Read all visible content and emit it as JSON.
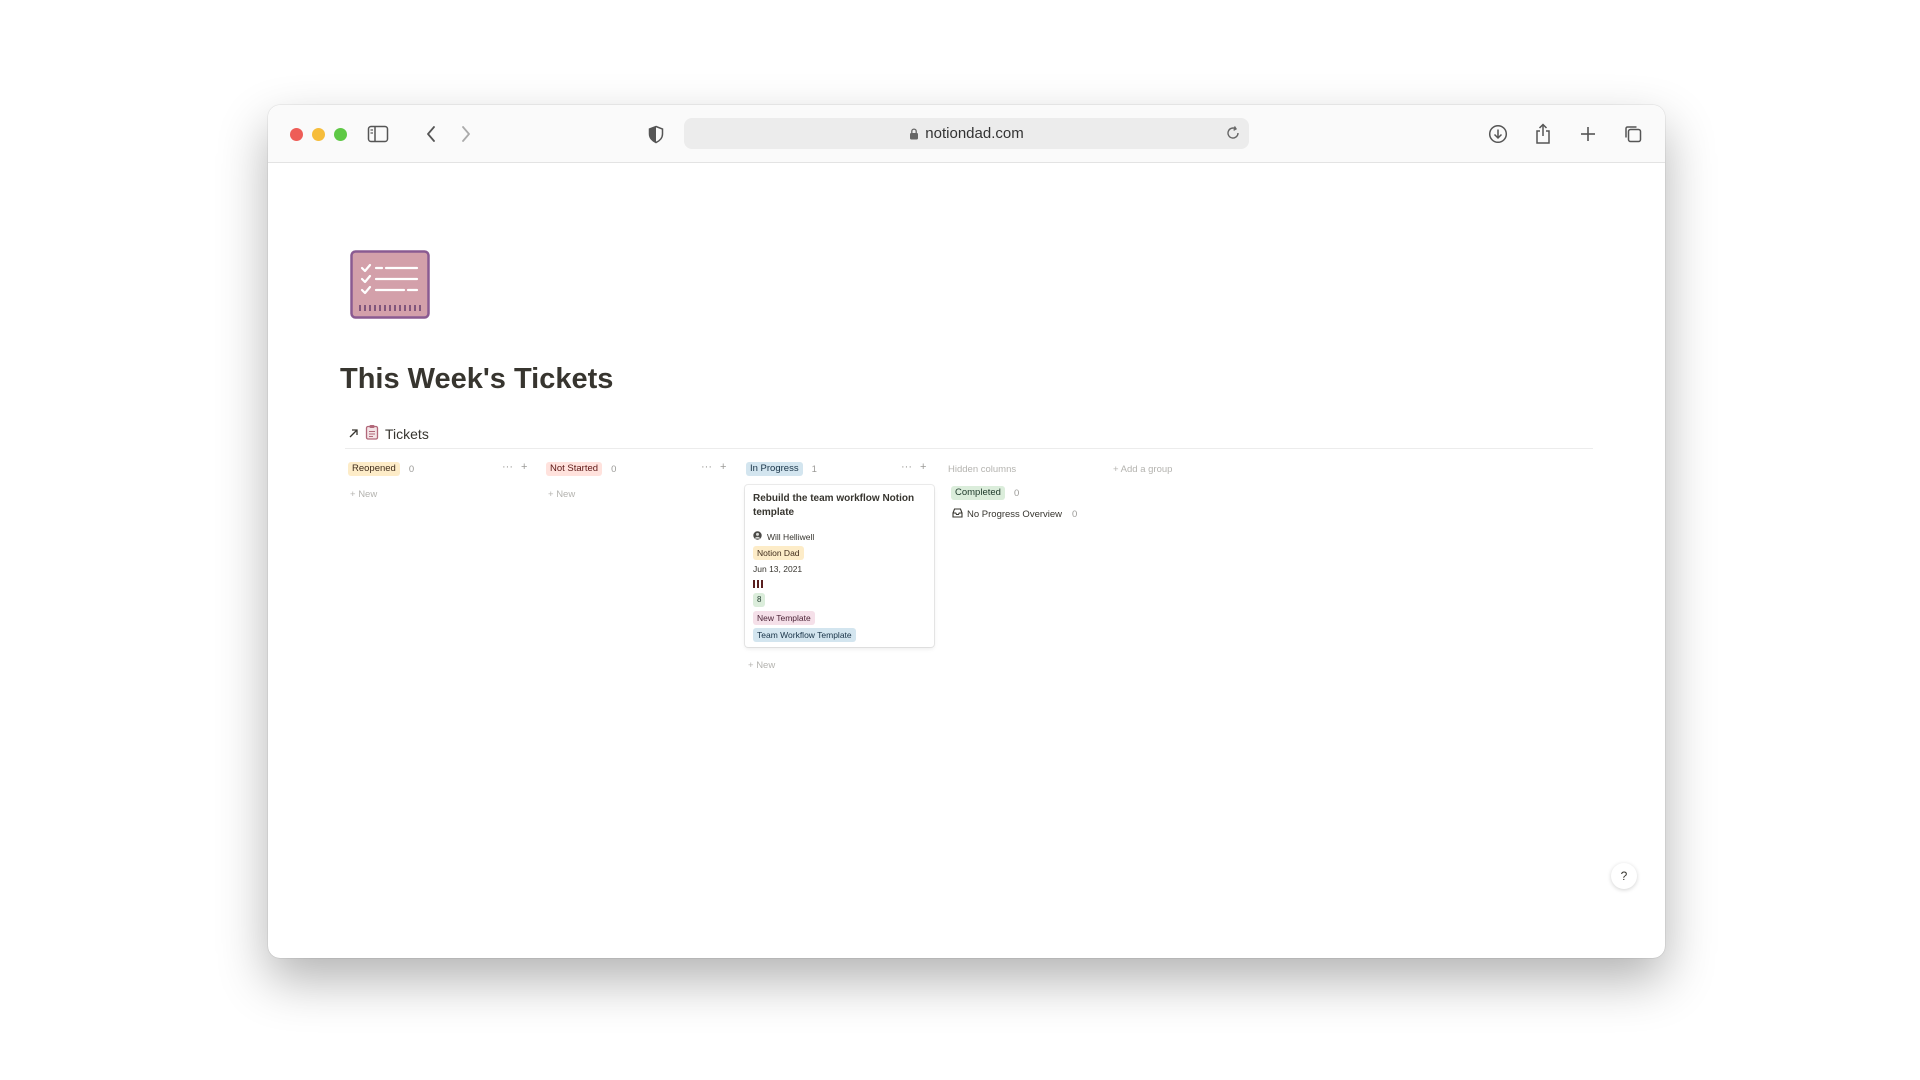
{
  "browser": {
    "url": "notiondad.com"
  },
  "page": {
    "title": "This Week's Tickets"
  },
  "database": {
    "link_label": "Tickets"
  },
  "board": {
    "columns": [
      {
        "label": "Reopened",
        "count": "0",
        "new_label": "New",
        "color_bg": "#fdecc8",
        "color_fg": "#402c1b"
      },
      {
        "label": "Not Started",
        "count": "0",
        "new_label": "New",
        "color_bg": "#ffe2dd",
        "color_fg": "#5d1715"
      },
      {
        "label": "In Progress",
        "count": "1",
        "new_label": "New",
        "color_bg": "#d3e5ef",
        "color_fg": "#183347"
      }
    ],
    "card": {
      "title": "Rebuild the team workflow Notion template",
      "assignee": "Will Helliwell",
      "company": "Notion Dad",
      "date": "Jun 13, 2021",
      "points": "8",
      "tags": [
        "New Template",
        "Team Workflow Template"
      ]
    },
    "hidden_columns_label": "Hidden columns",
    "add_group_label": "Add a group",
    "hidden": {
      "label": "Completed",
      "count": "0",
      "sub_label": "No Progress Overview",
      "sub_count": "0"
    }
  },
  "help_label": "?",
  "colors": {
    "text": "#37352f",
    "muted": "#9b9a97",
    "completed_bg": "#dbeddb",
    "completed_fg": "#1c3829",
    "company_bg": "#fdecc8",
    "points_bg": "#dbeddb",
    "tag_pink_bg": "#f5e0e9",
    "tag_blue_bg": "#d3e5ef"
  }
}
